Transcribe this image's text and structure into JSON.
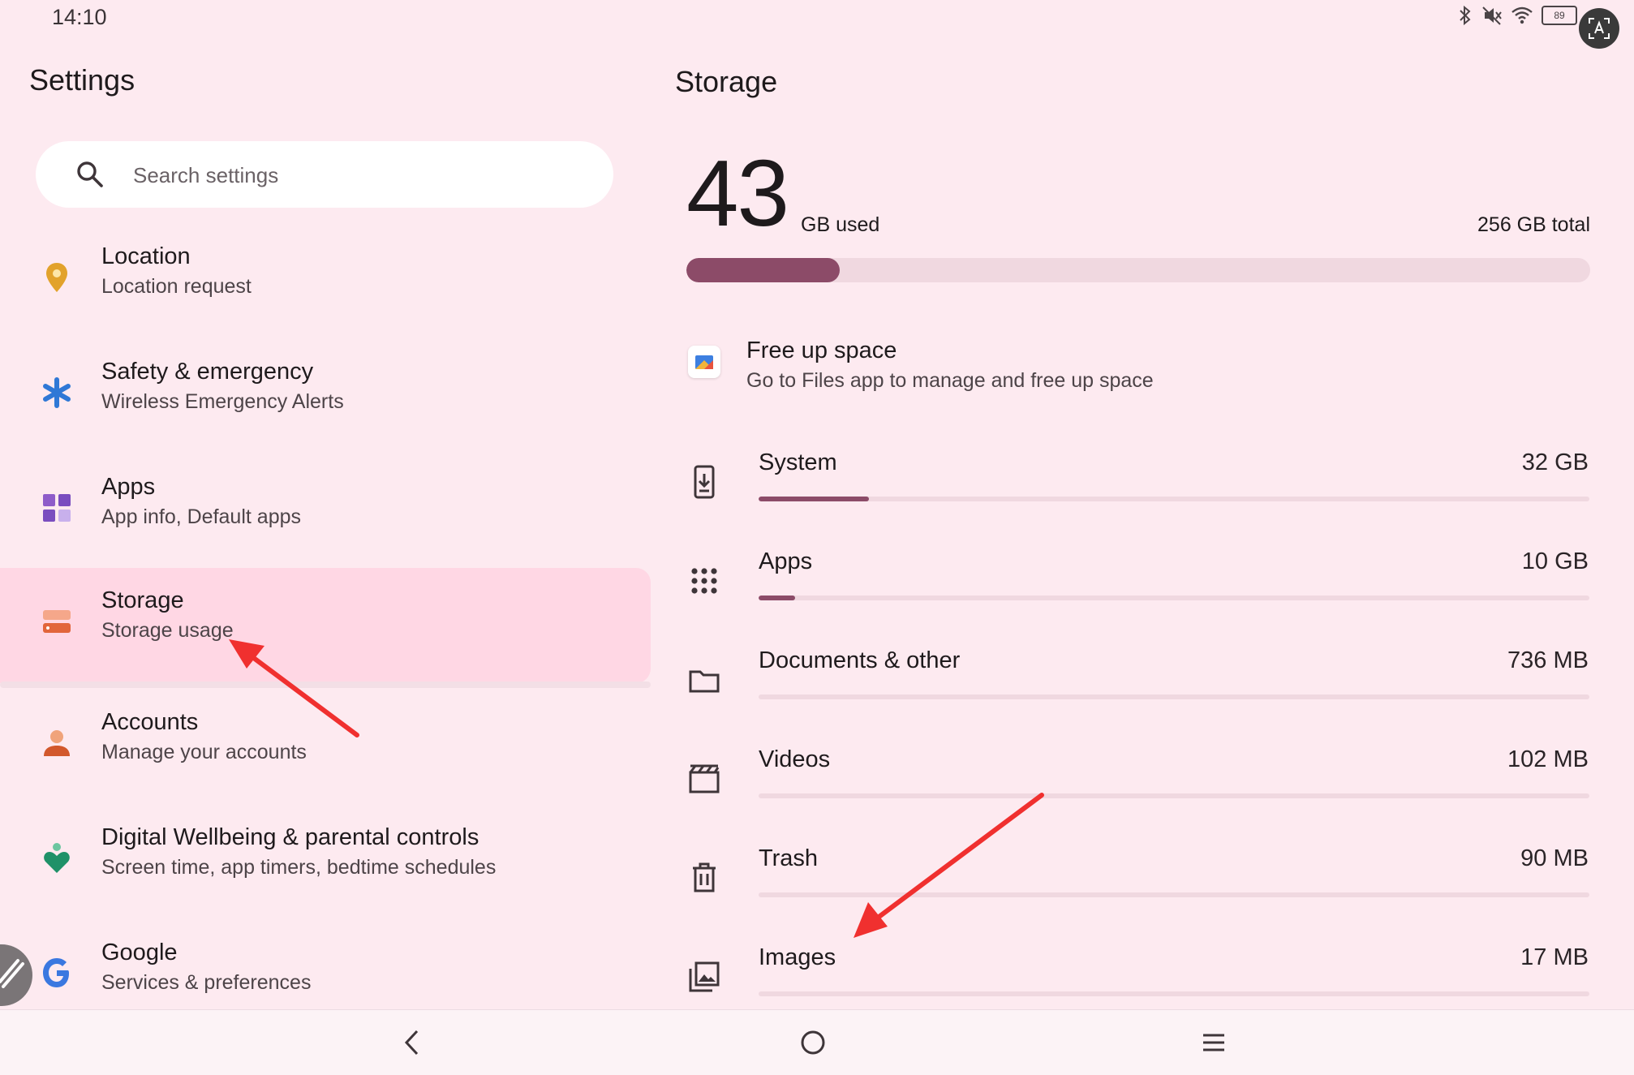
{
  "status_bar": {
    "time": "14:10",
    "battery": "89"
  },
  "settings": {
    "title": "Settings",
    "search": {
      "placeholder": "Search settings"
    },
    "items": [
      {
        "title": "Location",
        "subtitle": "Location request",
        "icon": "location-pin-icon"
      },
      {
        "title": "Safety & emergency",
        "subtitle": "Wireless Emergency Alerts",
        "icon": "asterisk-icon"
      },
      {
        "title": "Apps",
        "subtitle": "App info, Default apps",
        "icon": "apps-grid-icon"
      },
      {
        "title": "Storage",
        "subtitle": "Storage usage",
        "icon": "storage-icon",
        "selected": true
      },
      {
        "title": "Accounts",
        "subtitle": "Manage your accounts",
        "icon": "account-icon"
      },
      {
        "title": "Digital Wellbeing & parental controls",
        "subtitle": "Screen time, app timers, bedtime schedules",
        "icon": "wellbeing-icon"
      },
      {
        "title": "Google",
        "subtitle": "Services & preferences",
        "icon": "google-icon"
      }
    ]
  },
  "storage": {
    "title": "Storage",
    "used_value": "43",
    "used_label": "GB used",
    "total_label": "256 GB total",
    "used_fraction": 0.17,
    "free_up": {
      "title": "Free up space",
      "subtitle": "Go to Files app to manage and free up space",
      "icon": "files-app-icon"
    },
    "categories": [
      {
        "label": "System",
        "size": "32 GB",
        "fraction": 0.133,
        "icon": "phone-download-icon"
      },
      {
        "label": "Apps",
        "size": "10 GB",
        "fraction": 0.044,
        "icon": "apps-dots-icon"
      },
      {
        "label": "Documents & other",
        "size": "736 MB",
        "fraction": 0.0,
        "icon": "folder-icon"
      },
      {
        "label": "Videos",
        "size": "102 MB",
        "fraction": 0.0,
        "icon": "video-clapper-icon"
      },
      {
        "label": "Trash",
        "size": "90 MB",
        "fraction": 0.0,
        "icon": "trash-icon"
      },
      {
        "label": "Images",
        "size": "17 MB",
        "fraction": 0.0,
        "icon": "images-icon"
      }
    ]
  },
  "colors": {
    "accent": "#8c4b68",
    "background": "#fdeaf0",
    "selected": "#ffd7e4",
    "annotation": "#f0302f"
  }
}
